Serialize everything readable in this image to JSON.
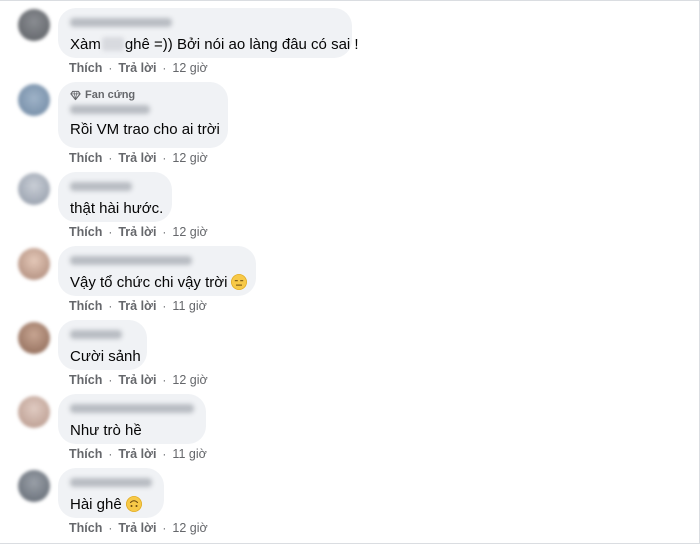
{
  "comments": [
    {
      "text_before": "Xàm",
      "text_after": "ghê =)) Bởi nói ao làng đâu có sai !",
      "like": "Thích",
      "reply": "Trả lời",
      "time": "12 giờ",
      "dot": "·"
    },
    {
      "badge": "Fan cứng",
      "badge_icon": "diamond-icon",
      "text": "Rồi VM trao cho ai trời",
      "like": "Thích",
      "reply": "Trả lời",
      "time": "12 giờ",
      "dot": "·"
    },
    {
      "text": "thật hài hước.",
      "like": "Thích",
      "reply": "Trả lời",
      "time": "12 giờ",
      "dot": "·"
    },
    {
      "text": "Vậy tổ chức chi vậy trời",
      "emoji": "expressionless-face-emoji",
      "like": "Thích",
      "reply": "Trả lời",
      "time": "11 giờ",
      "dot": "·"
    },
    {
      "text": "Cười sảnh",
      "like": "Thích",
      "reply": "Trả lời",
      "time": "12 giờ",
      "dot": "·"
    },
    {
      "text": "Như trò hề",
      "like": "Thích",
      "reply": "Trả lời",
      "time": "11 giờ",
      "dot": "·"
    },
    {
      "text": "Hài ghê",
      "emoji": "upside-down-face-emoji",
      "like": "Thích",
      "reply": "Trả lời",
      "time": "12 giờ",
      "dot": "·"
    }
  ],
  "colors": {
    "bubble": "#f0f2f5",
    "meta_text": "#65676b",
    "text": "#050505"
  }
}
